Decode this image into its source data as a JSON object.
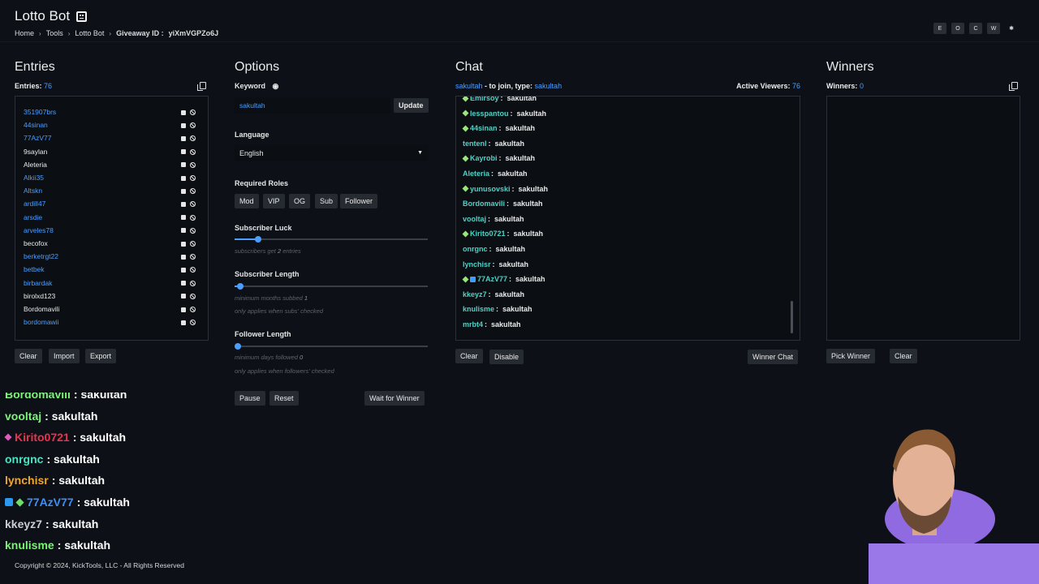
{
  "header": {
    "title": "Lotto Bot",
    "breadcrumb": [
      "Home",
      "Tools",
      "Lotto Bot",
      "Giveaway ID :",
      "yiXmVGPZo6J"
    ],
    "top_buttons": [
      "E",
      "O",
      "C",
      "W",
      "✱"
    ]
  },
  "entries": {
    "title": "Entries",
    "count_label": "Entries:",
    "count": "76",
    "items": [
      {
        "name": "351907brs",
        "color": "blue"
      },
      {
        "name": "44sinan",
        "color": "blue"
      },
      {
        "name": "77AzV77",
        "color": "blue"
      },
      {
        "name": "9saylan",
        "color": "white"
      },
      {
        "name": "Aleteria",
        "color": "white"
      },
      {
        "name": "Alkii35",
        "color": "blue"
      },
      {
        "name": "Altskn",
        "color": "blue"
      },
      {
        "name": "ardill47",
        "color": "blue"
      },
      {
        "name": "arsdie",
        "color": "blue"
      },
      {
        "name": "arveles78",
        "color": "blue"
      },
      {
        "name": "becofox",
        "color": "white"
      },
      {
        "name": "berketrgt22",
        "color": "blue"
      },
      {
        "name": "betbek",
        "color": "blue"
      },
      {
        "name": "birbardak",
        "color": "blue"
      },
      {
        "name": "birolxd123",
        "color": "white"
      },
      {
        "name": "Bordomavili",
        "color": "white"
      },
      {
        "name": "bordomawii",
        "color": "blue"
      }
    ],
    "buttons": {
      "clear": "Clear",
      "import": "Import",
      "export": "Export"
    }
  },
  "options": {
    "title": "Options",
    "keyword_label": "Keyword",
    "keyword_value": "sakultah",
    "update": "Update",
    "language_label": "Language",
    "language_value": "English",
    "roles_label": "Required Roles",
    "roles": [
      "Mod",
      "VIP",
      "OG",
      "Sub",
      "Follower"
    ],
    "sub_luck_label": "Subscriber Luck",
    "sub_luck_hint_prefix": "subscribers get",
    "sub_luck_value": "2",
    "sub_luck_hint_suffix": "entries",
    "sub_luck_level": 0.12,
    "sub_length_label": "Subscriber Length",
    "sub_length_hint_prefix": "minimum months subbed",
    "sub_length_value": "1",
    "sub_length_hint2": "only applies when subs' checked",
    "sub_length_level": 0.03,
    "follower_length_label": "Follower Length",
    "follower_length_hint_prefix": "minimum days followed",
    "follower_length_value": "0",
    "follower_length_hint2": "only applies when followers' checked",
    "follower_length_level": 0.0,
    "buttons": {
      "pause": "Pause",
      "reset": "Reset",
      "wait": "Wait for Winner"
    }
  },
  "chat": {
    "title": "Chat",
    "join_user": "sakultah",
    "join_text": " - to join, type:",
    "join_keyword": "sakultah",
    "viewers_label": "Active Viewers:",
    "viewers": "76",
    "messages": [
      {
        "name": "Emirsoy",
        "text": "sakultah",
        "badge": "gem"
      },
      {
        "name": "lesspantou",
        "text": "sakultah",
        "badge": "gem"
      },
      {
        "name": "44sinan",
        "text": "sakultah",
        "badge": "gem"
      },
      {
        "name": "tentenl",
        "text": "sakultah",
        "badge": ""
      },
      {
        "name": "Kayrobi",
        "text": "sakultah",
        "badge": "gem"
      },
      {
        "name": "Aleteria",
        "text": "sakultah",
        "badge": ""
      },
      {
        "name": "yunusovski",
        "text": "sakultah",
        "badge": "gem"
      },
      {
        "name": "Bordomavili",
        "text": "sakultah",
        "badge": ""
      },
      {
        "name": "vooltaj",
        "text": "sakultah",
        "badge": ""
      },
      {
        "name": "Kirito0721",
        "text": "sakultah",
        "badge": "gem"
      },
      {
        "name": "onrgnc",
        "text": "sakultah",
        "badge": ""
      },
      {
        "name": "lynchisr",
        "text": "sakultah",
        "badge": ""
      },
      {
        "name": "77AzV77",
        "text": "sakultah",
        "badge": "gem-blue"
      },
      {
        "name": "kkeyz7",
        "text": "sakultah",
        "badge": ""
      },
      {
        "name": "knulisme",
        "text": "sakultah",
        "badge": ""
      },
      {
        "name": "mrbt4",
        "text": "sakultah",
        "badge": ""
      }
    ],
    "buttons": {
      "clear": "Clear",
      "disable": "Disable",
      "winner_chat": "Winner Chat"
    }
  },
  "winners": {
    "title": "Winners",
    "count_label": "Winners:",
    "count": "0",
    "buttons": {
      "pick": "Pick Winner",
      "clear": "Clear"
    }
  },
  "overlay_chat": [
    {
      "name": "Bordomavili",
      "text": ": sakultah",
      "color": "green",
      "badge": ""
    },
    {
      "name": "vooltaj",
      "text": ": sakultah",
      "color": "green",
      "badge": ""
    },
    {
      "name": "Kirito0721",
      "text": ": sakultah",
      "color": "red",
      "badge": "pink"
    },
    {
      "name": "onrgnc",
      "text": ": sakultah",
      "color": "teal",
      "badge": ""
    },
    {
      "name": "lynchisr",
      "text": ": sakultah",
      "color": "orange",
      "badge": ""
    },
    {
      "name": "77AzV77",
      "text": ": sakultah",
      "color": "blue",
      "badge": "blue-green"
    },
    {
      "name": "kkeyz7",
      "text": ": sakultah",
      "color": "grey",
      "badge": ""
    },
    {
      "name": "knulisme",
      "text": ": sakultah",
      "color": "green",
      "badge": ""
    }
  ],
  "footer": "Copyright © 2024, KickTools, LLC - All Rights Reserved"
}
